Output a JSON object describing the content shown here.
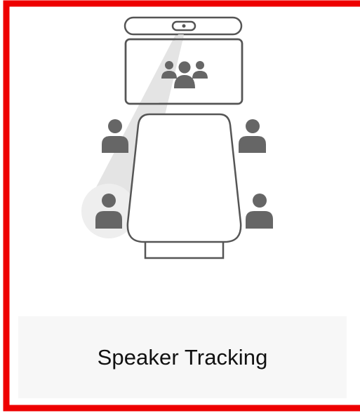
{
  "card": {
    "caption": "Speaker Tracking",
    "border_color": "#ee0000",
    "caption_bg": "#f7f7f7"
  },
  "icons": {
    "camera": "camera-bar-icon",
    "display": "display-screen-icon",
    "group": "group-of-people-icon",
    "table": "conference-table-icon",
    "person": "person-icon"
  },
  "colors": {
    "outline": "#555555",
    "person_fill": "#666666",
    "beam": "#e3e3e3",
    "spotlight": "#f0f0f0"
  }
}
